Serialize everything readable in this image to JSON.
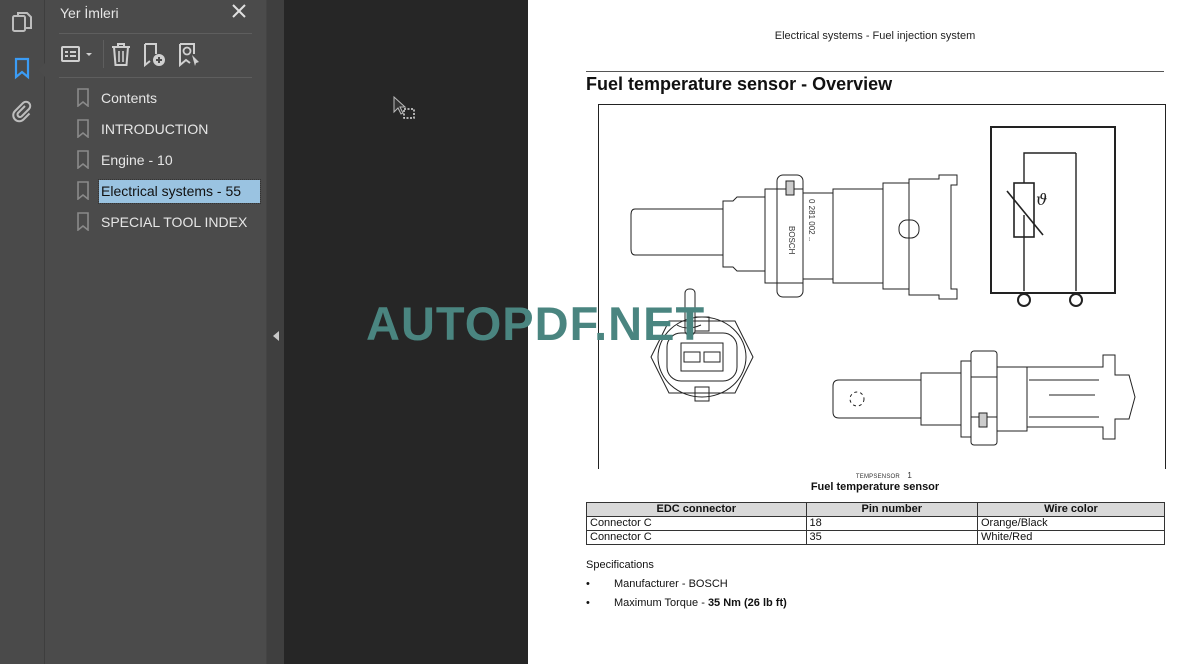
{
  "nav_rail": {
    "items": [
      {
        "name": "page-thumbnails",
        "icon": "pages-icon",
        "active": false
      },
      {
        "name": "bookmarks",
        "icon": "bookmark-icon",
        "active": true
      },
      {
        "name": "attachments",
        "icon": "paperclip-icon",
        "active": false
      }
    ],
    "accent_color": "#3b9cf5"
  },
  "bookmarks_panel": {
    "title": "Yer İmleri",
    "toolbar": [
      "options-menu-icon",
      "delete-icon",
      "add-bookmark-icon",
      "find-bookmark-icon"
    ],
    "items": [
      {
        "label": "Contents",
        "selected": false
      },
      {
        "label": "INTRODUCTION",
        "selected": false
      },
      {
        "label": "Engine - 10",
        "selected": false
      },
      {
        "label": "Electrical systems - 55",
        "selected": true
      },
      {
        "label": "SPECIAL TOOL INDEX",
        "selected": false
      }
    ],
    "selection_color": "#9ac3e1"
  },
  "document": {
    "running_header": "Electrical systems - Fuel injection system",
    "heading": "Fuel temperature sensor - Overview",
    "figure": {
      "id_label": "TEMPSENSOR",
      "id_number": "1",
      "caption": "Fuel temperature sensor",
      "part_marking_brand": "BOSCH",
      "part_marking_number": "0 281 002 ..",
      "symbol": "ϑ"
    },
    "table": {
      "headers": [
        "EDC connector",
        "Pin number",
        "Wire color"
      ],
      "rows": [
        [
          "Connector C",
          "18",
          "Orange/Black"
        ],
        [
          "Connector C",
          "35",
          "White/Red"
        ]
      ]
    },
    "specifications": {
      "title": "Specifications",
      "items": [
        {
          "bullet": "•",
          "text": "Manufacturer - BOSCH",
          "bold": ""
        },
        {
          "bullet": "•",
          "text": "Maximum Torque - ",
          "bold": "35 Nm (26 lb ft)"
        }
      ]
    }
  },
  "watermark": {
    "text": "AUTOPDF.NET",
    "color": "#4a8580"
  }
}
